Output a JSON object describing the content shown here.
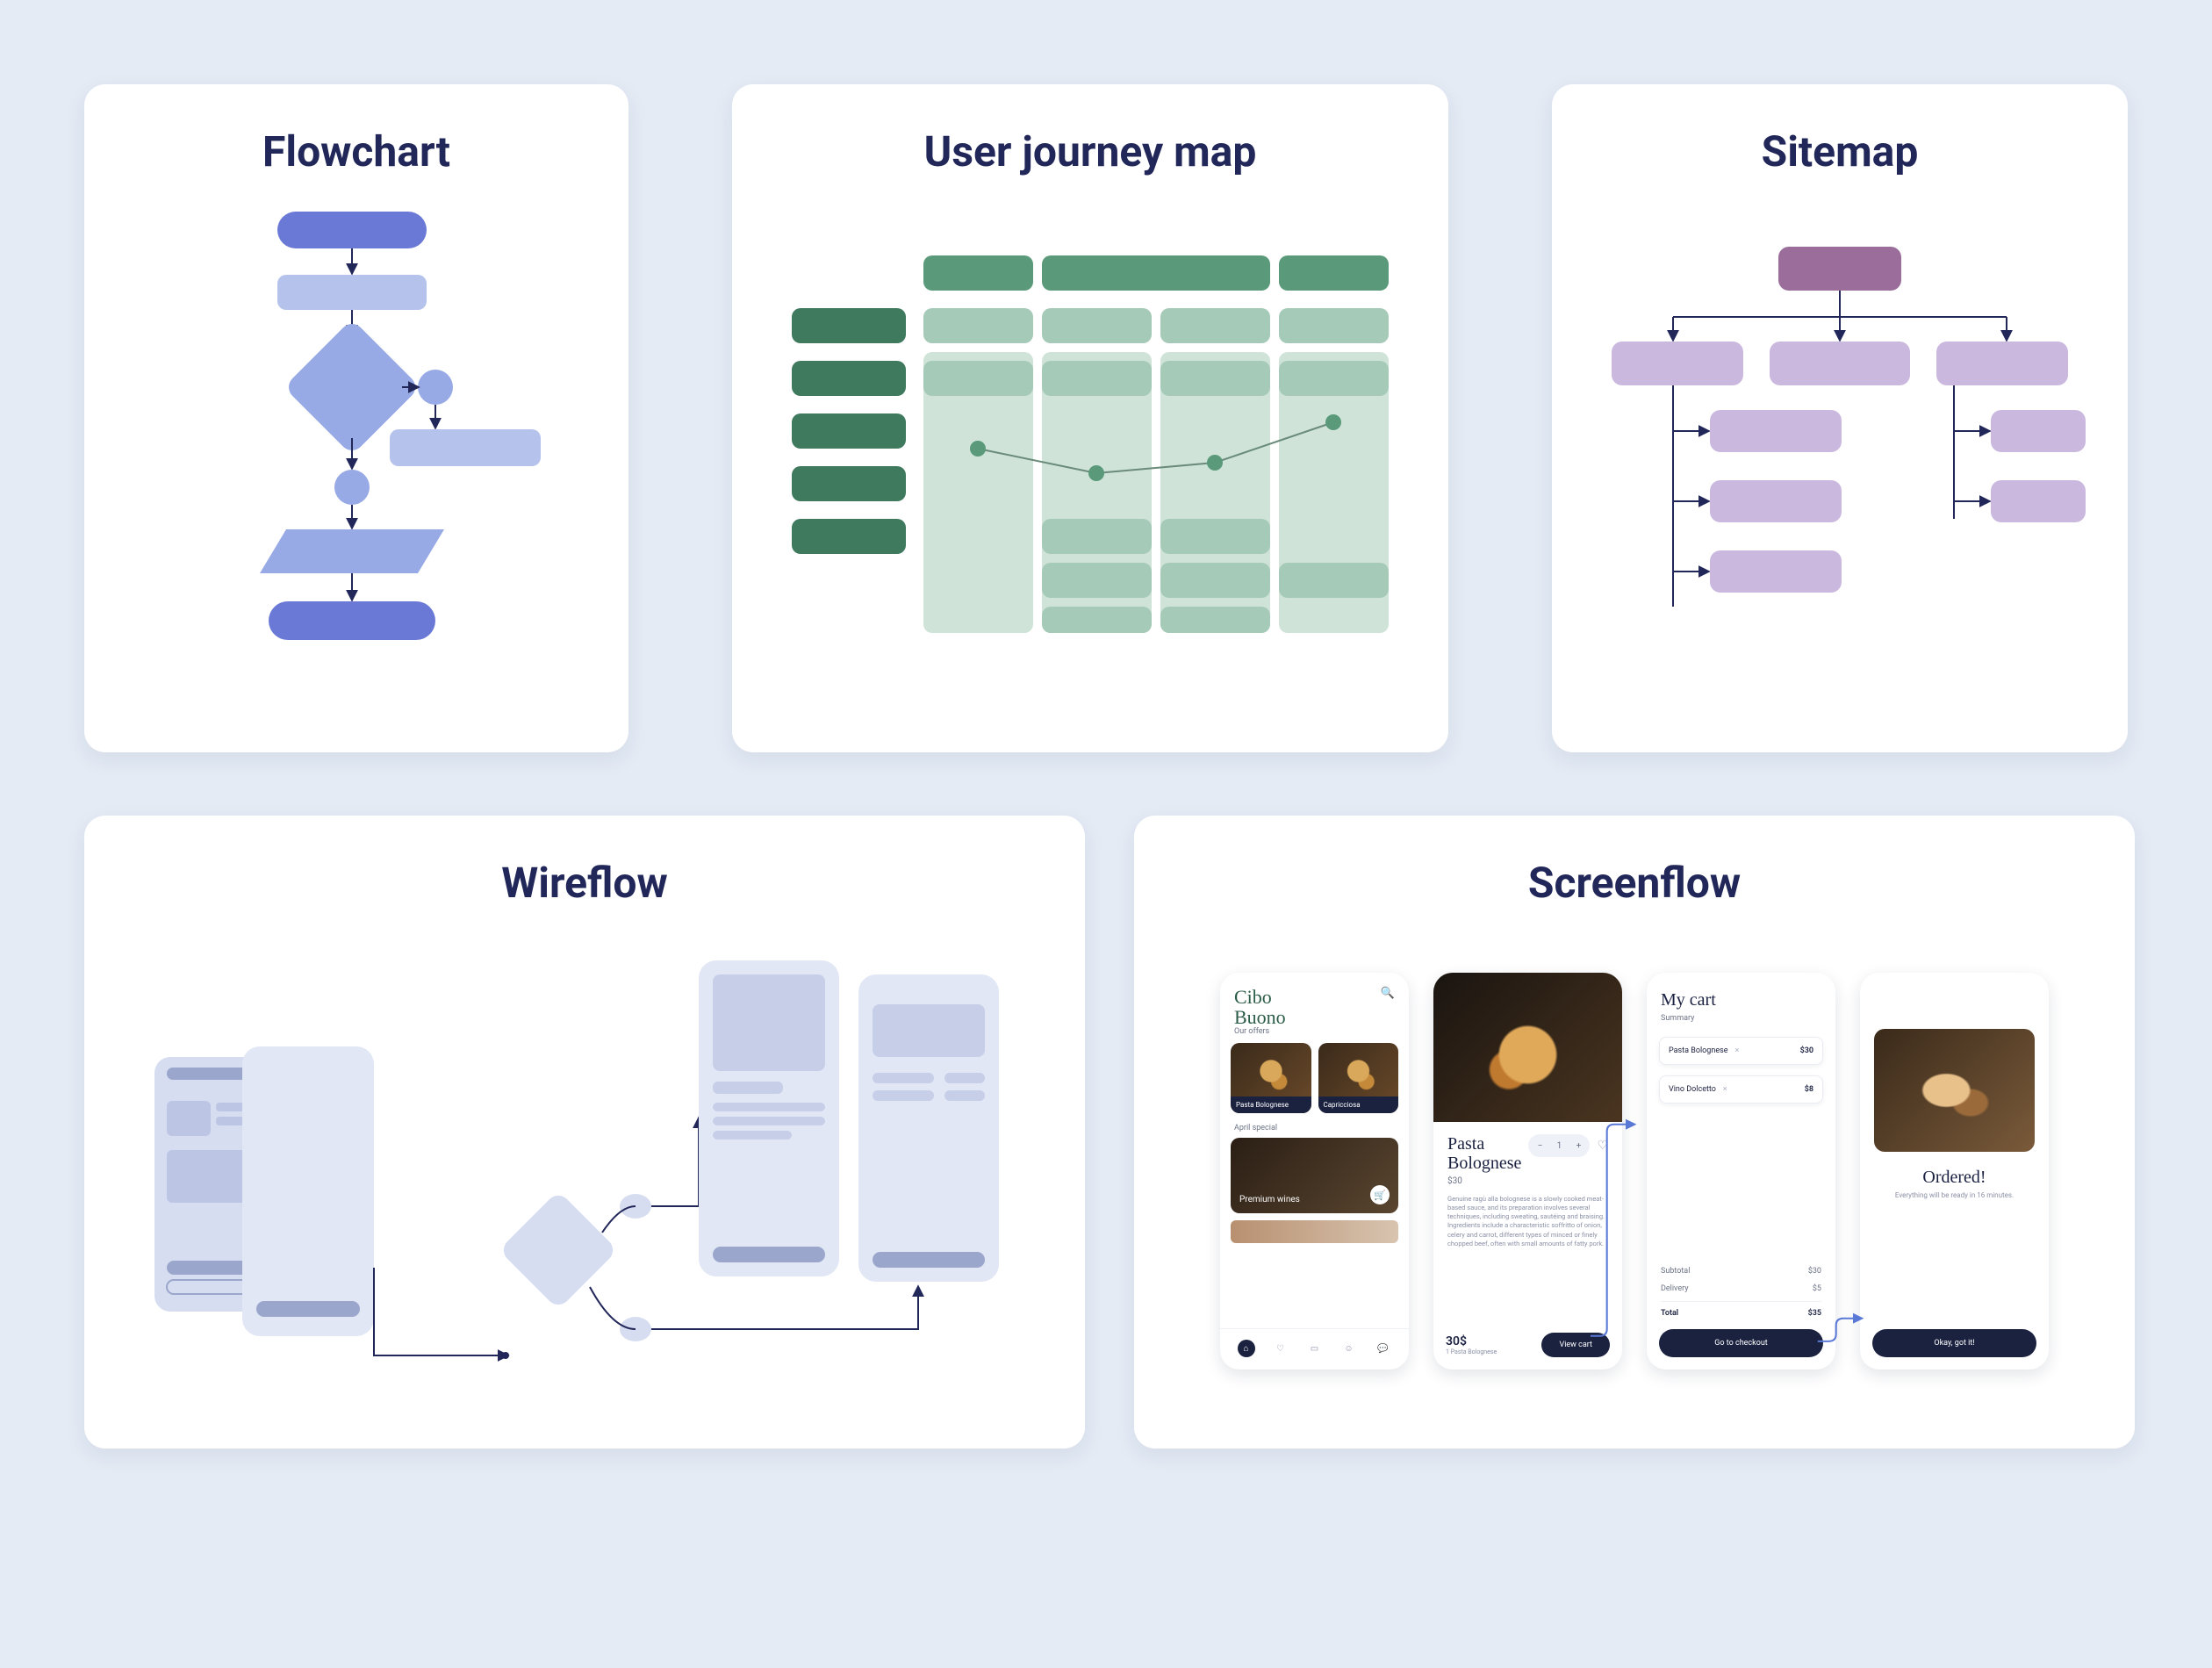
{
  "cards": {
    "flowchart": {
      "title": "Flowchart"
    },
    "journey": {
      "title": "User journey map"
    },
    "sitemap": {
      "title": "Sitemap"
    },
    "wireflow": {
      "title": "Wireflow"
    },
    "screenflow": {
      "title": "Screenflow"
    }
  },
  "screenflow": {
    "home": {
      "brand_line1": "Cibo",
      "brand_line2": "Buono",
      "section1": "Our offers",
      "dish1": "Pasta Bolognese",
      "dish2": "Capricciosa",
      "section2": "April special",
      "special": "Premium wines"
    },
    "detail": {
      "title_line1": "Pasta",
      "title_line2": "Bolognese",
      "price": "$30",
      "desc": "Genuine ragù alla bolognese is a slowly cooked meat-based sauce, and its preparation involves several techniques, including sweating, sautéing and braising. Ingredients include a characteristic soffritto of onion, celery and carrot, different types of minced or finely chopped beef, often with small amounts of fatty pork.",
      "footer_price": "30$",
      "footer_sub": "1 Pasta Bolognese",
      "view_cart": "View cart"
    },
    "cart": {
      "title": "My cart",
      "summary": "Summary",
      "item1_name": "Pasta Bolognese",
      "item1_price": "$30",
      "item2_name": "Vino Dolcetto",
      "item2_price": "$8",
      "subtotal_label": "Subtotal",
      "subtotal": "$30",
      "delivery_label": "Delivery",
      "delivery": "$5",
      "total_label": "Total",
      "total": "$35",
      "checkout": "Go to checkout"
    },
    "confirm": {
      "title": "Ordered!",
      "sub": "Everything will be ready in 16 minutes.",
      "ok": "Okay, got it!"
    }
  }
}
